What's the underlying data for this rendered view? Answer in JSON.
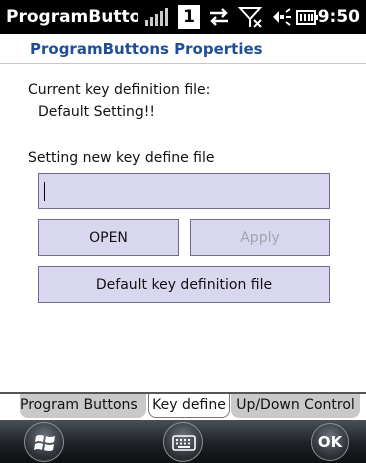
{
  "status_bar": {
    "app_title": "ProgramButtons",
    "badge_number": "1",
    "time": "9:50",
    "icons": [
      "signal-bars-icon",
      "sync-icon",
      "wifi-disabled-icon",
      "volume-icon",
      "battery-icon"
    ]
  },
  "header": {
    "title": "ProgramButtons Properties"
  },
  "content": {
    "current_label": "Current key definition file:",
    "current_value": "Default Setting!!",
    "new_label": "Setting new key define file",
    "file_input_value": "",
    "open_label": "OPEN",
    "apply_label": "Apply",
    "default_label": "Default key definition file"
  },
  "tabs": [
    {
      "label": "Program Buttons",
      "active": false
    },
    {
      "label": "Key define",
      "active": true
    },
    {
      "label": "Up/Down Control",
      "active": false
    }
  ],
  "softkeys": {
    "ok_label": "OK",
    "icons": [
      "windows-start-icon",
      "keyboard-icon"
    ]
  },
  "colors": {
    "header_text": "#1f4e98",
    "button_fill": "#d9d7ef",
    "disabled_text": "#a3a3ad"
  }
}
